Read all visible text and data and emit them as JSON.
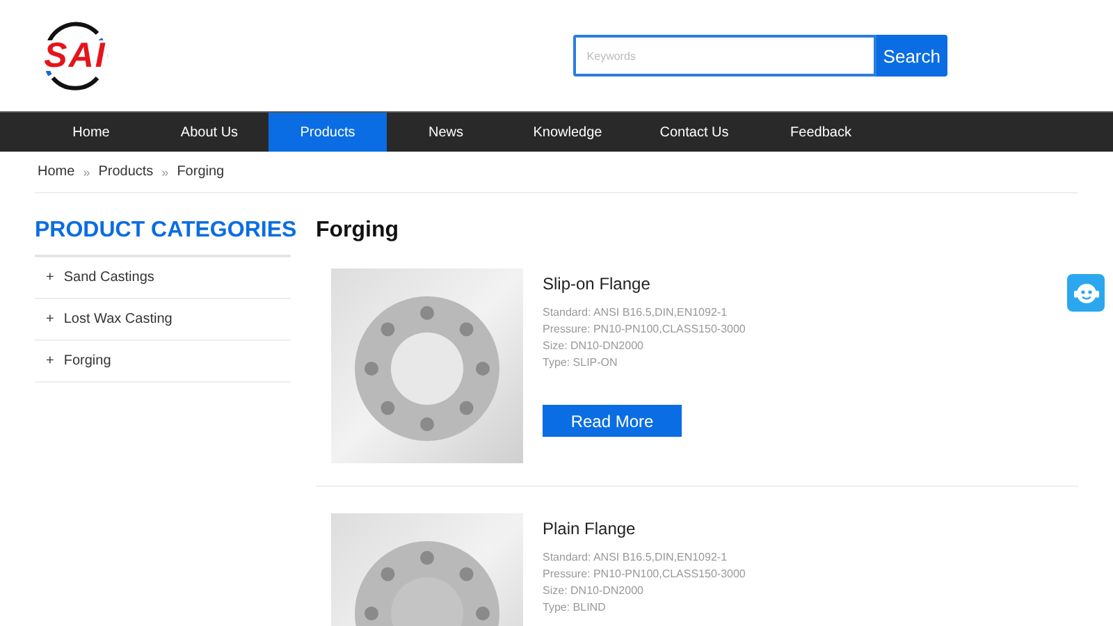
{
  "logo": {
    "text": "SAI"
  },
  "search": {
    "placeholder": "Keywords",
    "button": "Search"
  },
  "nav": [
    {
      "label": "Home",
      "selected": false
    },
    {
      "label": "About Us",
      "selected": false
    },
    {
      "label": "Products",
      "selected": true
    },
    {
      "label": "News",
      "selected": false
    },
    {
      "label": "Knowledge",
      "selected": false
    },
    {
      "label": "Contact Us",
      "selected": false
    },
    {
      "label": "Feedback",
      "selected": false
    }
  ],
  "breadcrumb": {
    "items": [
      "Home",
      "Products",
      "Forging"
    ],
    "separator": "»"
  },
  "sidebar": {
    "title": "PRODUCT CATEGORIES",
    "items": [
      {
        "icon": "+",
        "label": "Sand Castings"
      },
      {
        "icon": "+",
        "label": "Lost Wax Casting"
      },
      {
        "icon": "+",
        "label": "Forging"
      }
    ]
  },
  "page_title": "Forging",
  "products": [
    {
      "name": "Slip-on Flange",
      "specs": [
        "Standard: ANSI B16.5,DIN,EN1092-1",
        "Pressure: PN10-PN100,CLASS150-3000",
        "Size: DN10-DN2000",
        "Type: SLIP-ON"
      ],
      "button": "Read More"
    },
    {
      "name": "Plain Flange",
      "specs": [
        "Standard: ANSI B16.5,DIN,EN1092-1",
        "Pressure: PN10-PN100,CLASS150-3000",
        "Size: DN10-DN2000",
        "Type: BLIND"
      ]
    }
  ]
}
